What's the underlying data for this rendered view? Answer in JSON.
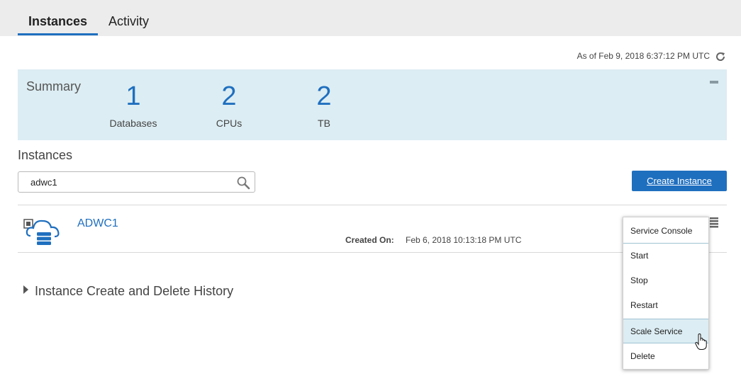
{
  "tabs": [
    {
      "label": "Instances",
      "active": true
    },
    {
      "label": "Activity",
      "active": false
    }
  ],
  "as_of": "As of Feb 9, 2018 6:37:12 PM UTC",
  "summary": {
    "title": "Summary",
    "metrics": [
      {
        "value": "1",
        "label": "Databases"
      },
      {
        "value": "2",
        "label": "CPUs"
      },
      {
        "value": "2",
        "label": "TB"
      }
    ]
  },
  "instances_section": {
    "title": "Instances",
    "search_value": "adwc1",
    "create_button": "Create Instance"
  },
  "instance": {
    "name": "ADWC1",
    "created_label": "Created On:",
    "created_value": "Feb 6, 2018 10:13:18 PM UTC"
  },
  "history_label": "Instance Create and Delete History",
  "context_menu": {
    "items": [
      "Service Console",
      "Start",
      "Stop",
      "Restart",
      "Scale Service",
      "Delete"
    ],
    "highlighted": "Scale Service"
  },
  "colors": {
    "accent": "#1f6fbf",
    "summary_bg": "#dcedf3",
    "tabbar_bg": "#ececec"
  }
}
